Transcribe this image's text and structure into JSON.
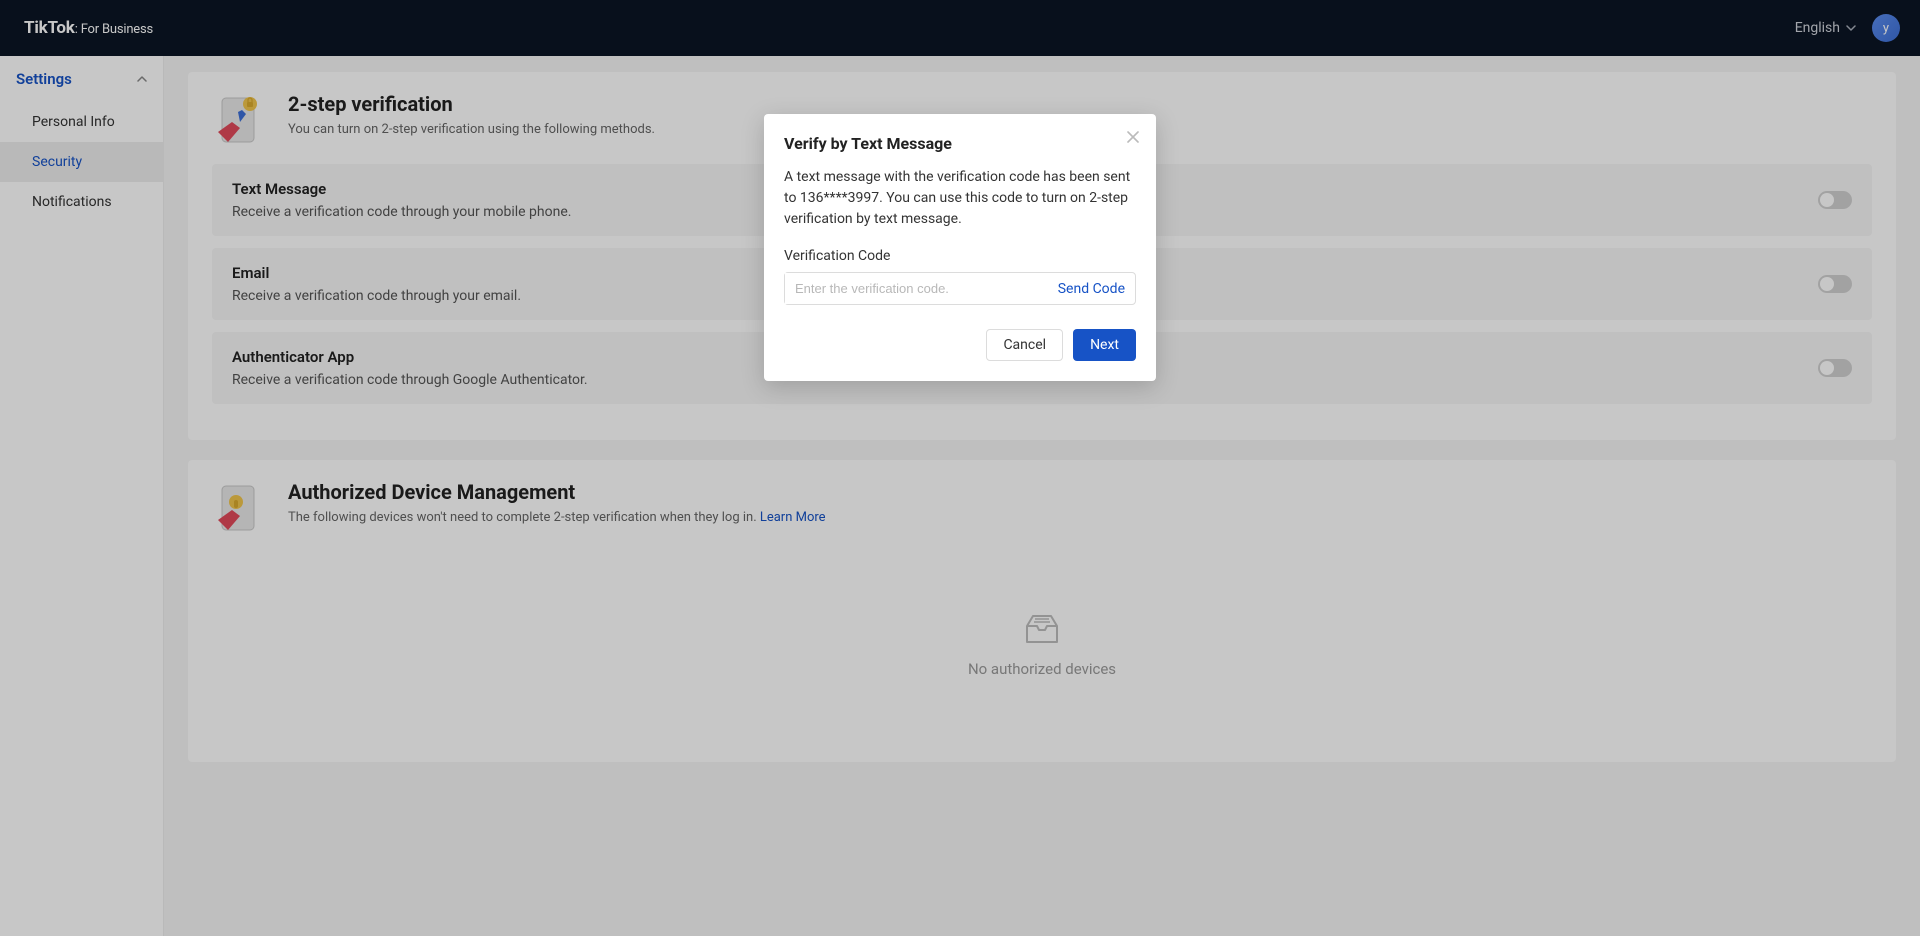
{
  "header": {
    "logo_main": "TikTok",
    "logo_sep": ": ",
    "logo_sub": "For Business",
    "language": "English",
    "avatar_letter": "y"
  },
  "sidebar": {
    "group_label": "Settings",
    "items": [
      {
        "label": "Personal Info"
      },
      {
        "label": "Security"
      },
      {
        "label": "Notifications"
      }
    ]
  },
  "two_step": {
    "title": "2-step verification",
    "subtitle": "You can turn on 2-step verification using the following methods.",
    "methods": {
      "sms": {
        "title": "Text Message",
        "desc": "Receive a verification code through your mobile phone."
      },
      "email": {
        "title": "Email",
        "desc": "Receive a verification code through your email."
      },
      "authenticator": {
        "title": "Authenticator App",
        "desc": "Receive a verification code through Google Authenticator."
      }
    }
  },
  "devices": {
    "title": "Authorized Device Management",
    "subtitle_pre": "The following devices won't need to complete 2-step verification when they log in. ",
    "learn_more": "Learn More",
    "empty": "No authorized devices"
  },
  "modal": {
    "title": "Verify by Text Message",
    "body": "A text message with the verification code has been sent to 136****3997. You can use this code to turn on 2-step verification by text message.",
    "field_label": "Verification Code",
    "input_placeholder": "Enter the verification code.",
    "send_code": "Send Code",
    "cancel": "Cancel",
    "next": "Next"
  }
}
